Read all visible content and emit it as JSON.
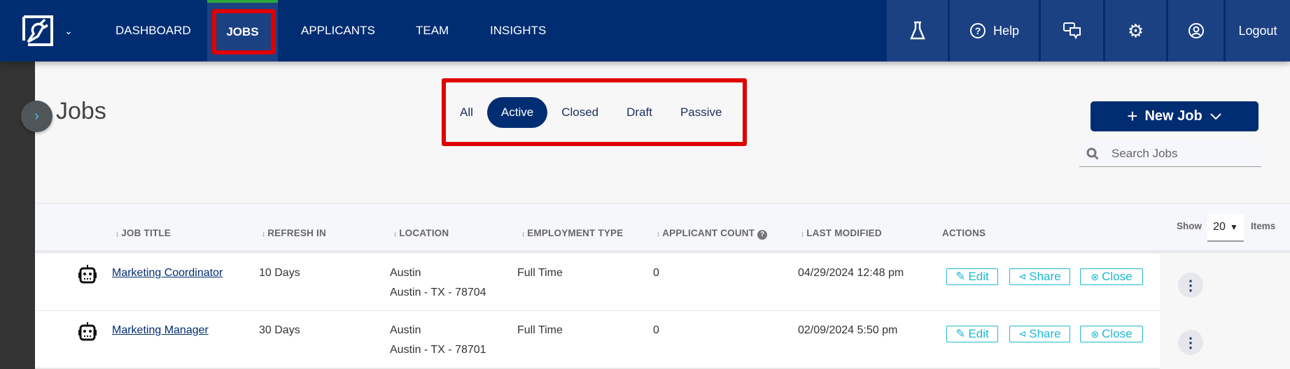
{
  "nav": {
    "items": [
      "DASHBOARD",
      "JOBS",
      "APPLICANTS",
      "TEAM",
      "INSIGHTS"
    ],
    "active": "JOBS",
    "help": "Help",
    "logout": "Logout"
  },
  "page": {
    "title": "Jobs"
  },
  "filters": {
    "items": [
      "All",
      "Active",
      "Closed",
      "Draft",
      "Passive"
    ],
    "active": "Active"
  },
  "new_job": "New Job",
  "search": {
    "placeholder": "Search Jobs",
    "value": ""
  },
  "table": {
    "headers": [
      "JOB TITLE",
      "REFRESH IN",
      "LOCATION",
      "EMPLOYMENT TYPE",
      "APPLICANT COUNT",
      "LAST MODIFIED",
      "ACTIONS"
    ],
    "show_label": "Show",
    "page_size": "20",
    "items_label": "Items",
    "actions": {
      "edit": "Edit",
      "share": "Share",
      "close": "Close"
    },
    "rows": [
      {
        "title": "Marketing Coordinator",
        "refresh": "10 Days",
        "city": "Austin",
        "location": "Austin - TX - 78704",
        "type": "Full Time",
        "count": "0",
        "modified": "04/29/2024 12:48 pm"
      },
      {
        "title": "Marketing Manager",
        "refresh": "30 Days",
        "city": "Austin",
        "location": "Austin - TX - 78701",
        "type": "Full Time",
        "count": "0",
        "modified": "02/09/2024 5:50 pm"
      }
    ]
  },
  "colors": {
    "nav": "#002d72",
    "nav_active": "#1b4183",
    "accent": "#1fb8cf",
    "highlight": "#e00000",
    "active_bar": "#2aa837"
  }
}
